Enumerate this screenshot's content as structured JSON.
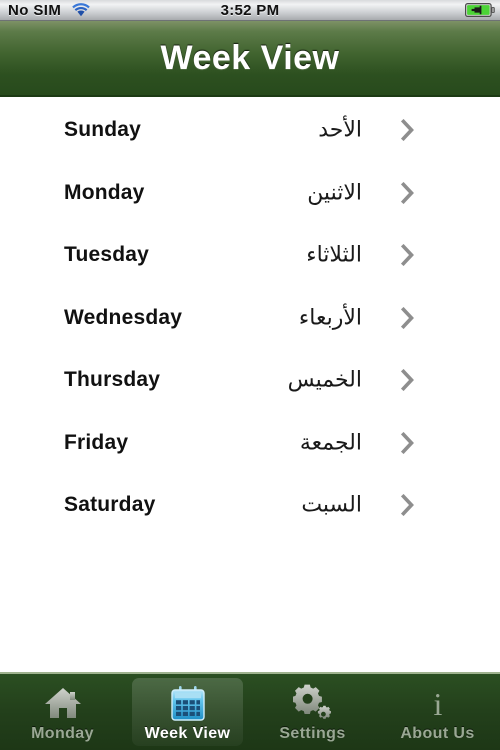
{
  "status_bar": {
    "carrier": "No SIM",
    "time": "3:52 PM",
    "wifi_icon": "wifi-icon",
    "battery_icon": "battery-charging-icon"
  },
  "nav_bar": {
    "title": "Week View",
    "gradient_top": "#7e9266",
    "gradient_bottom": "#274a1c"
  },
  "list": {
    "rows": [
      {
        "english": "Sunday",
        "arabic": "الأحد"
      },
      {
        "english": "Monday",
        "arabic": "الاثنين"
      },
      {
        "english": "Tuesday",
        "arabic": "الثلاثاء"
      },
      {
        "english": "Wednesday",
        "arabic": "الأربعاء"
      },
      {
        "english": "Thursday",
        "arabic": "الخميس"
      },
      {
        "english": "Friday",
        "arabic": "الجمعة"
      },
      {
        "english": "Saturday",
        "arabic": "السبت"
      }
    ],
    "disclosure_icon": "chevron-right-icon"
  },
  "tab_bar": {
    "selected_index": 1,
    "tabs": [
      {
        "label": "Monday",
        "icon": "home-icon",
        "selected": false
      },
      {
        "label": "Week View",
        "icon": "calendar-icon",
        "selected": true
      },
      {
        "label": "Settings",
        "icon": "gears-icon",
        "selected": false
      },
      {
        "label": "About Us",
        "icon": "info-icon",
        "selected": false
      }
    ]
  },
  "colors": {
    "brand_green_dark": "#274a1c",
    "brand_green_light": "#7e9266",
    "tab_bar_bg": "#23401b",
    "calendar_icon_blue": "#49b7e8",
    "chevron_gray": "#8e8e8e",
    "battery_green": "#4cd437",
    "wifi_blue": "#1f4fa8"
  }
}
